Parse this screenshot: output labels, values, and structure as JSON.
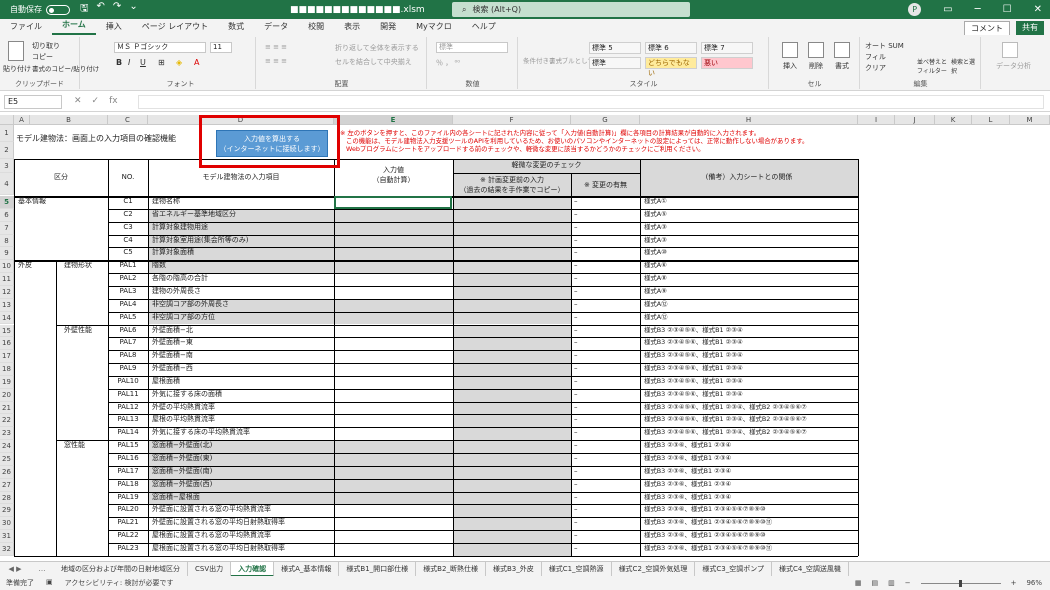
{
  "titlebar": {
    "autosave_label": "自動保存",
    "autosave_state": "オフ",
    "filename": "■■■■■■■■■■■■■.xlsm",
    "search_placeholder": "検索 (Alt+Q)",
    "avatar": "P"
  },
  "menu": {
    "tabs": [
      "ファイル",
      "ホーム",
      "挿入",
      "ページ レイアウト",
      "数式",
      "データ",
      "校閲",
      "表示",
      "開発",
      "Myマクロ",
      "ヘルプ"
    ],
    "active": "ホーム",
    "comment_label": "コメント",
    "share_label": "共有"
  },
  "ribbon": {
    "clipboard": {
      "paste": "貼り付け",
      "cut": "切り取り",
      "copy": "コピー",
      "format_painter": "書式のコピー/貼り付け",
      "label": "クリップボード"
    },
    "font": {
      "name": "ＭＳ Ｐゴシック",
      "size": "11",
      "label": "フォント"
    },
    "align": {
      "wrap": "折り返して全体を表示する",
      "merge": "セルを結合して中央揃え",
      "label": "配置"
    },
    "number": {
      "format": "標準",
      "label": "数値"
    },
    "cond": {
      "conditional": "条件付き書式",
      "table": "テーブルとして書式設定"
    },
    "styles": {
      "cells": [
        "標準 5",
        "標準 6",
        "標準 7",
        "標準",
        "どちらでもない",
        "悪い"
      ],
      "label": "スタイル"
    },
    "cells": {
      "insert": "挿入",
      "delete": "削除",
      "format": "書式",
      "label": "セル"
    },
    "editing": {
      "autosum": "オート SUM",
      "fill": "フィル",
      "clear": "クリア",
      "sort": "並べ替えとフィルター",
      "find": "検索と選択",
      "label": "編集"
    },
    "analyze": {
      "label": "データ分析"
    }
  },
  "formula_bar": {
    "name_box": "E5",
    "fx": "fx",
    "value": ""
  },
  "sheet": {
    "columns": [
      "A",
      "B",
      "C",
      "D",
      "E",
      "F",
      "G",
      "H",
      "I",
      "J",
      "K",
      "L",
      "M"
    ],
    "title": "モデル建物法：画面上の入力項目の確認機能",
    "button_line1": "入力値を算出する",
    "button_line2": "（インターネットに接続します）",
    "notes": [
      "※ 左のボタンを押すと、このファイル内の各シートに記された内容に従って「入力値(自動計算)」欄に各項目の計算結果が自動的に入力されます。",
      "この機能は、モデル建物法入力支援ツールのAPIを利用しているため、お使いのパソコンやインターネットの設定によっては、正常に動作しない場合があります。",
      "Webプログラムにシートをアップロードする前のチェックや、軽微な変更に該当するかどうかのチェックにご利用ください。"
    ],
    "headers": {
      "kubun": "区分",
      "no": "NO.",
      "item": "モデル建物法の入力項目",
      "input1": "入力値",
      "input2": "（自動計算）",
      "minor": "軽微な変更のチェック",
      "plan1": "※ 計画変更前の入力",
      "plan2": "（過去の結果を手作業でコピー）",
      "change": "※ 変更の有無",
      "note": "(備考）入力シートとの関係"
    },
    "rows": [
      {
        "r": "5",
        "a": "基本情報",
        "b": "",
        "no": "C1",
        "item": "建物名称",
        "g": "–",
        "h": "様式A①",
        "grey": false
      },
      {
        "r": "6",
        "a": "",
        "b": "",
        "no": "C2",
        "item": "省エネルギー基準地域区分",
        "g": "–",
        "h": "様式A⑤",
        "grey": true
      },
      {
        "r": "7",
        "a": "",
        "b": "",
        "no": "C3",
        "item": "計算対象建物用途",
        "g": "–",
        "h": "様式A③",
        "grey": true
      },
      {
        "r": "8",
        "a": "",
        "b": "",
        "no": "C4",
        "item": "計算対象室用途(集会所等のみ)",
        "g": "–",
        "h": "様式A③",
        "grey": true
      },
      {
        "r": "9",
        "a": "",
        "b": "",
        "no": "C5",
        "item": "計算対象面積",
        "g": "–",
        "h": "様式A⑩",
        "grey": true
      },
      {
        "r": "10",
        "a": "外皮",
        "b": "建物形状",
        "no": "PAL1",
        "item": "階数",
        "g": "–",
        "h": "様式A⑥",
        "grey": true
      },
      {
        "r": "11",
        "a": "",
        "b": "",
        "no": "PAL2",
        "item": "各階の階高の合計",
        "g": "–",
        "h": "様式A⑧",
        "grey": false
      },
      {
        "r": "12",
        "a": "",
        "b": "",
        "no": "PAL3",
        "item": "建物の外周長さ",
        "g": "–",
        "h": "様式A⑨",
        "grey": false
      },
      {
        "r": "13",
        "a": "",
        "b": "",
        "no": "PAL4",
        "item": "非空調コア部の外周長さ",
        "g": "–",
        "h": "様式A⑫",
        "grey": true
      },
      {
        "r": "14",
        "a": "",
        "b": "",
        "no": "PAL5",
        "item": "非空調コア部の方位",
        "g": "–",
        "h": "様式A⑫",
        "grey": true
      },
      {
        "r": "15",
        "a": "",
        "b": "外壁性能",
        "no": "PAL6",
        "item": "外壁面積−北",
        "g": "–",
        "h": "様式B3 ②③④⑤⑥、様式B1 ②③④",
        "grey": false
      },
      {
        "r": "16",
        "a": "",
        "b": "",
        "no": "PAL7",
        "item": "外壁面積−東",
        "g": "–",
        "h": "様式B3 ②③④⑤⑥、様式B1 ②③④",
        "grey": false
      },
      {
        "r": "17",
        "a": "",
        "b": "",
        "no": "PAL8",
        "item": "外壁面積−南",
        "g": "–",
        "h": "様式B3 ②③④⑤⑥、様式B1 ②③④",
        "grey": false
      },
      {
        "r": "18",
        "a": "",
        "b": "",
        "no": "PAL9",
        "item": "外壁面積−西",
        "g": "–",
        "h": "様式B3 ②③④⑤⑥、様式B1 ②③④",
        "grey": false
      },
      {
        "r": "19",
        "a": "",
        "b": "",
        "no": "PAL10",
        "item": "屋根面積",
        "g": "–",
        "h": "様式B3 ②③④⑤⑥、様式B1 ②③④",
        "grey": false
      },
      {
        "r": "20",
        "a": "",
        "b": "",
        "no": "PAL11",
        "item": "外気に接する床の面積",
        "g": "–",
        "h": "様式B3 ②③④⑤⑥、様式B1 ②③④",
        "grey": false
      },
      {
        "r": "21",
        "a": "",
        "b": "",
        "no": "PAL12",
        "item": "外壁の平均熱貫流率",
        "g": "–",
        "h": "様式B3 ②③④⑤⑥、様式B1 ②③④、様式B2 ②③④⑤⑥⑦",
        "grey": false
      },
      {
        "r": "22",
        "a": "",
        "b": "",
        "no": "PAL13",
        "item": "屋根の平均熱貫流率",
        "g": "–",
        "h": "様式B3 ②③④⑤⑥、様式B1 ②③④、様式B2 ②③④⑤⑥⑦",
        "grey": false
      },
      {
        "r": "23",
        "a": "",
        "b": "",
        "no": "PAL14",
        "item": "外気に接する床の平均熱貫流率",
        "g": "–",
        "h": "様式B3 ②③④⑤⑥、様式B1 ②③④、様式B2 ②③④⑤⑥⑦",
        "grey": false
      },
      {
        "r": "24",
        "a": "",
        "b": "窓性能",
        "no": "PAL15",
        "item": "窓面積−外壁面(北)",
        "g": "–",
        "h": "様式B3 ②③⑥、様式B1 ②③④",
        "grey": true
      },
      {
        "r": "25",
        "a": "",
        "b": "",
        "no": "PAL16",
        "item": "窓面積−外壁面(東)",
        "g": "–",
        "h": "様式B3 ②③⑥、様式B1 ②③④",
        "grey": true
      },
      {
        "r": "26",
        "a": "",
        "b": "",
        "no": "PAL17",
        "item": "窓面積−外壁面(南)",
        "g": "–",
        "h": "様式B3 ②③⑥、様式B1 ②③④",
        "grey": true
      },
      {
        "r": "27",
        "a": "",
        "b": "",
        "no": "PAL18",
        "item": "窓面積−外壁面(西)",
        "g": "–",
        "h": "様式B3 ②③⑥、様式B1 ②③④",
        "grey": true
      },
      {
        "r": "28",
        "a": "",
        "b": "",
        "no": "PAL19",
        "item": "窓面積−屋根面",
        "g": "–",
        "h": "様式B3 ②③⑥、様式B1 ②③④",
        "grey": true
      },
      {
        "r": "29",
        "a": "",
        "b": "",
        "no": "PAL20",
        "item": "外壁面に設置される窓の平均熱貫流率",
        "g": "–",
        "h": "様式B3 ②③⑥、様式B1 ②③④⑤⑥⑦⑧⑨⑩",
        "grey": false
      },
      {
        "r": "30",
        "a": "",
        "b": "",
        "no": "PAL21",
        "item": "外壁面に設置される窓の平均日射熱取得率",
        "g": "–",
        "h": "様式B3 ②③⑥、様式B1 ②③④⑤⑥⑦⑧⑨⑩⑪",
        "grey": false
      },
      {
        "r": "31",
        "a": "",
        "b": "",
        "no": "PAL22",
        "item": "屋根面に設置される窓の平均熱貫流率",
        "g": "–",
        "h": "様式B3 ②③⑥、様式B1 ②③④⑤⑥⑦⑧⑨⑩",
        "grey": false
      },
      {
        "r": "32",
        "a": "",
        "b": "",
        "no": "PAL23",
        "item": "屋根面に設置される窓の平均日射熱取得率",
        "g": "–",
        "h": "様式B3 ②③⑥、様式B1 ②③④⑤⑥⑦⑧⑨⑩⑪",
        "grey": false
      }
    ]
  },
  "sheet_tabs": [
    "地域の区分および年間の日射地域区分",
    "CSV出力",
    "入力確認",
    "様式A_基本情報",
    "様式B1_開口部仕様",
    "様式B2_断熱仕様",
    "様式B3_外皮",
    "様式C1_空調熱源",
    "様式C2_空調外気処理",
    "様式C3_空調ポンプ",
    "様式C4_空調送風機"
  ],
  "active_sheet_tab": "入力確認",
  "status": {
    "ready": "準備完了",
    "accessibility": "アクセシビリティ: 検討が必要です",
    "zoom": "96%"
  }
}
